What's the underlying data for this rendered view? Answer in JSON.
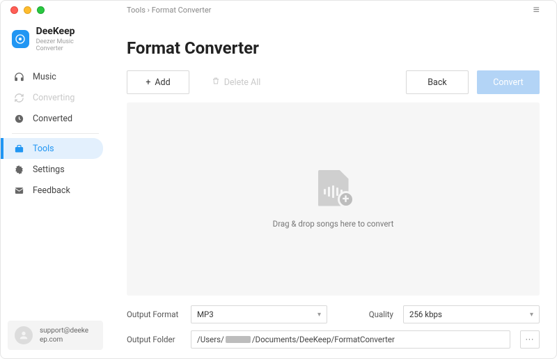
{
  "app": {
    "name": "DeeKeep",
    "subtitle": "Deezer Music Converter"
  },
  "breadcrumb": {
    "parent": "Tools",
    "current": "Format Converter"
  },
  "nav": {
    "music": "Music",
    "converting": "Converting",
    "converted": "Converted",
    "tools": "Tools",
    "settings": "Settings",
    "feedback": "Feedback"
  },
  "support": {
    "line1": "support@deeke",
    "line2": "ep.com"
  },
  "page": {
    "title": "Format Converter"
  },
  "toolbar": {
    "add": "Add",
    "delete_all": "Delete All",
    "back": "Back",
    "convert": "Convert"
  },
  "dropzone": {
    "hint": "Drag & drop songs here to convert"
  },
  "form": {
    "output_format_label": "Output Format",
    "output_format_value": "MP3",
    "quality_label": "Quality",
    "quality_value": "256 kbps",
    "output_folder_label": "Output Folder",
    "output_folder_prefix": "/Users/",
    "output_folder_suffix": "/Documents/DeeKeep/FormatConverter",
    "browse": "···"
  }
}
